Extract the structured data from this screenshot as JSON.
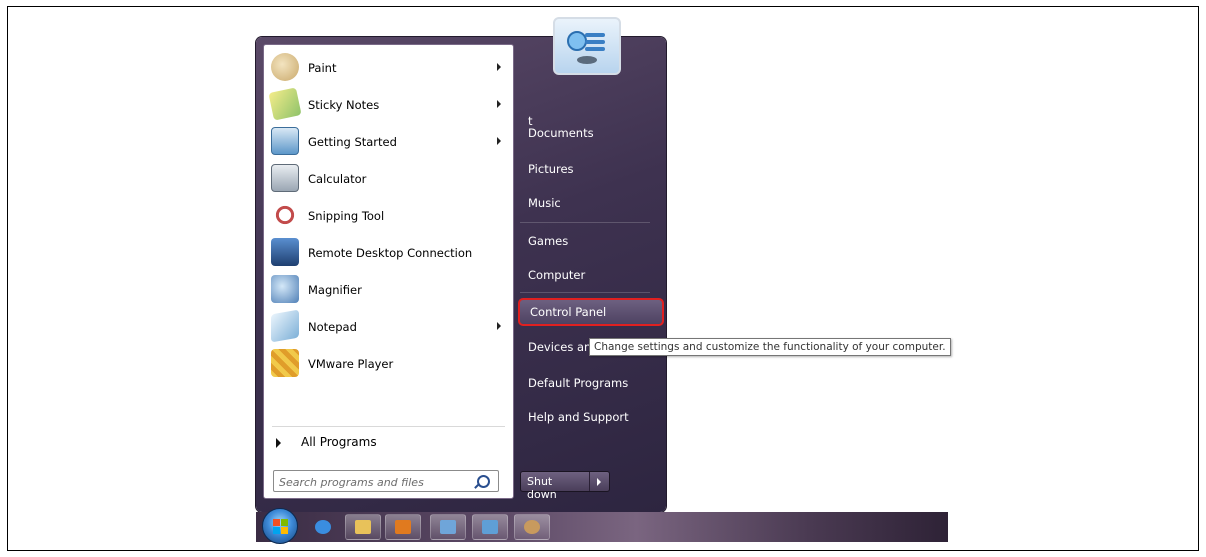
{
  "start_menu": {
    "programs": [
      {
        "label": "Paint",
        "has_submenu": true,
        "icon": "paint-icon",
        "color": "#c9a86a"
      },
      {
        "label": "Sticky Notes",
        "has_submenu": true,
        "icon": "sticky-notes-icon",
        "color": "#e6d84e"
      },
      {
        "label": "Getting Started",
        "has_submenu": true,
        "icon": "getting-started-icon",
        "color": "#5d97c9"
      },
      {
        "label": "Calculator",
        "has_submenu": false,
        "icon": "calculator-icon",
        "color": "#7c8a99"
      },
      {
        "label": "Snipping Tool",
        "has_submenu": false,
        "icon": "snipping-tool-icon",
        "color": "#c24b4b"
      },
      {
        "label": "Remote Desktop Connection",
        "has_submenu": false,
        "icon": "remote-desktop-icon",
        "color": "#3f6ea8"
      },
      {
        "label": "Magnifier",
        "has_submenu": false,
        "icon": "magnifier-icon",
        "color": "#4f7fb6"
      },
      {
        "label": "Notepad",
        "has_submenu": true,
        "icon": "notepad-icon",
        "color": "#7fb1d8"
      },
      {
        "label": "VMware Player",
        "has_submenu": false,
        "icon": "vmware-player-icon",
        "color": "#e2b33a"
      }
    ],
    "all_programs_label": "All Programs",
    "search": {
      "placeholder": "Search programs and files",
      "value": ""
    },
    "right_items": {
      "user": "t",
      "documents": "Documents",
      "pictures": "Pictures",
      "music": "Music",
      "games": "Games",
      "computer": "Computer",
      "control_panel": "Control Panel",
      "devices": "Devices and Printers",
      "default_programs": "Default Programs",
      "help": "Help and Support"
    },
    "shutdown_label": "Shut down",
    "tooltip": "Change settings and customize the functionality of your computer.",
    "highlight_color": "#e02020"
  },
  "taskbar": {
    "buttons": [
      {
        "name": "internet-explorer-icon",
        "color": "#3a8de0"
      },
      {
        "name": "windows-explorer-icon",
        "color": "#e8c25a"
      },
      {
        "name": "media-player-icon",
        "color": "#e07a1f"
      },
      {
        "name": "putty-icon",
        "color": "#6fa5d9"
      },
      {
        "name": "remote-desktop-taskbar-icon",
        "color": "#5f9fd6"
      },
      {
        "name": "paint-taskbar-icon",
        "color": "#c89a5e"
      }
    ]
  }
}
